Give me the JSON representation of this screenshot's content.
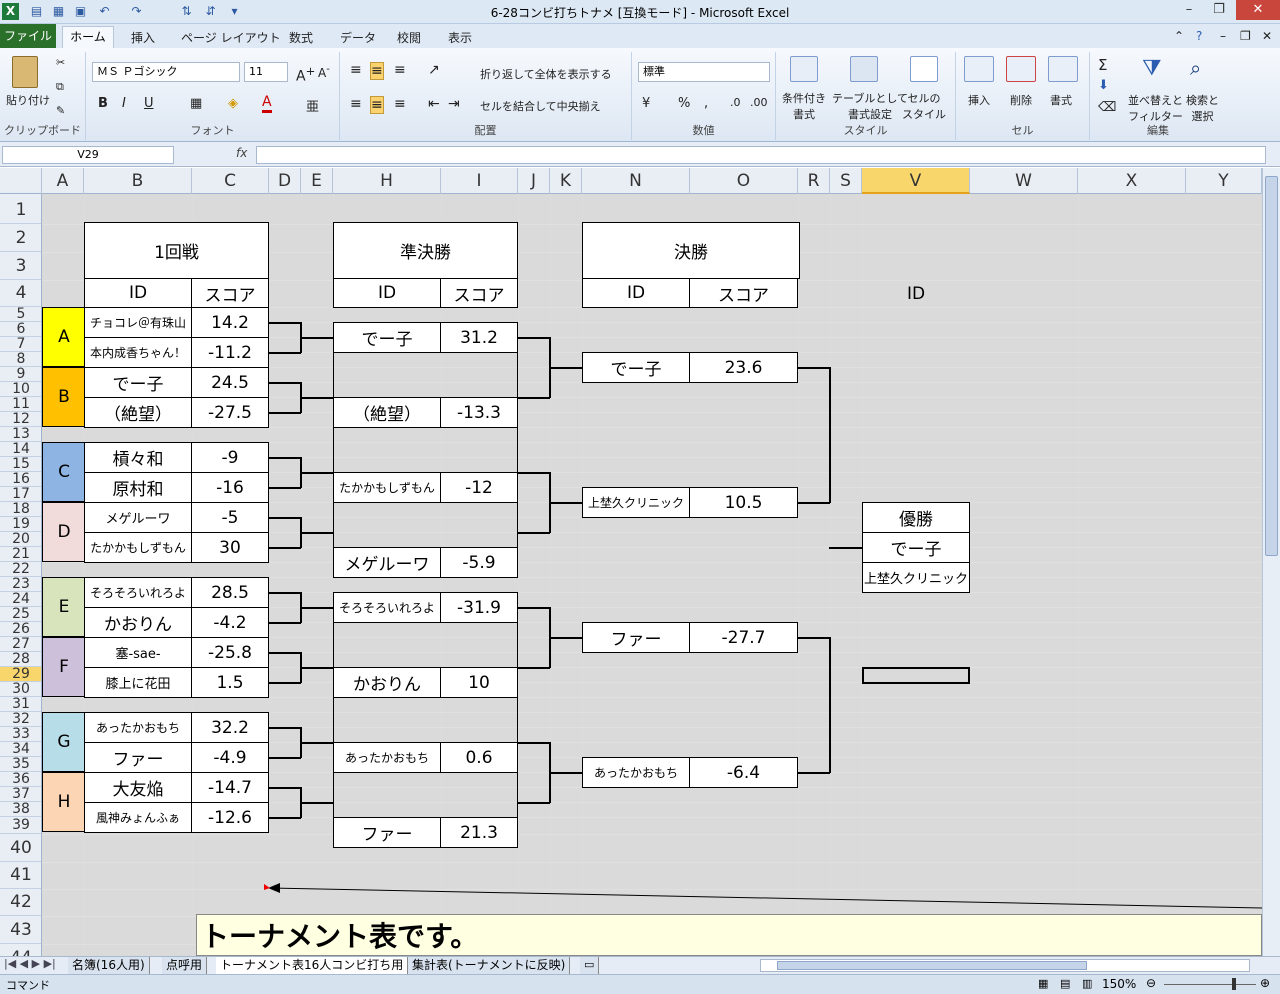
{
  "window": {
    "title": "6-28コンビ打ちトナメ [互換モード] - Microsoft Excel"
  },
  "ribbon": {
    "file_tab": "ファイル",
    "tabs": [
      "ホーム",
      "挿入",
      "ページ レイアウト",
      "数式",
      "データ",
      "校閲",
      "表示"
    ],
    "paste": "貼り付け",
    "clipboard": "クリップボード",
    "font_group": "フォント",
    "font_name": "ＭＳ Ｐゴシック",
    "font_size": "11",
    "wrap_text": "折り返して全体を表示する",
    "merge_center": "セルを結合して中央揃え",
    "alignment": "配置",
    "number_format": "標準",
    "number": "数値",
    "cond_format": "条件付き\n書式",
    "table_format": "テーブルとして\n書式設定",
    "cell_style": "セルの\nスタイル",
    "styles": "スタイル",
    "insert": "挿入",
    "delete": "削除",
    "format": "書式",
    "cells": "セル",
    "sort_filter": "並べ替えと\nフィルター",
    "find_select": "検索と\n選択",
    "editing": "編集"
  },
  "formula_bar": {
    "name_box": "V29",
    "fx": "fx",
    "value": ""
  },
  "columns": [
    "A",
    "B",
    "C",
    "D",
    "E",
    "H",
    "I",
    "J",
    "K",
    "N",
    "O",
    "R",
    "S",
    "V",
    "W",
    "X",
    "Y"
  ],
  "rows": [
    "1",
    "2",
    "3",
    "4",
    "5",
    "6",
    "7",
    "8",
    "9",
    "10",
    "11",
    "12",
    "13",
    "14",
    "15",
    "16",
    "17",
    "18",
    "19",
    "20",
    "21",
    "22",
    "23",
    "24",
    "25",
    "26",
    "27",
    "28",
    "29",
    "30",
    "31",
    "32",
    "33",
    "34",
    "35",
    "36",
    "37",
    "38",
    "39",
    "40",
    "41",
    "42",
    "43",
    "44"
  ],
  "bracket": {
    "round1_title": "1回戦",
    "semi_title": "準決勝",
    "final_title": "決勝",
    "id_header": "ID",
    "score_header": "スコア",
    "winner_id_header": "ID",
    "groups": [
      {
        "label": "A",
        "color": "#ffff00",
        "players": [
          {
            "id": "チョコレ＠有珠山",
            "score": "14.2"
          },
          {
            "id": "本内成香ちゃん！",
            "score": "-11.2"
          }
        ]
      },
      {
        "label": "B",
        "color": "#ffc000",
        "players": [
          {
            "id": "でー子",
            "score": "24.5"
          },
          {
            "id": "（絶望）",
            "score": "-27.5"
          }
        ]
      },
      {
        "label": "C",
        "color": "#8eb4e3",
        "players": [
          {
            "id": "槓々和",
            "score": "-9"
          },
          {
            "id": "原村和",
            "score": "-16"
          }
        ]
      },
      {
        "label": "D",
        "color": "#f2dcdb",
        "players": [
          {
            "id": "メゲルーワ",
            "score": "-5"
          },
          {
            "id": "たかかもしずもん",
            "score": "30"
          }
        ]
      },
      {
        "label": "E",
        "color": "#d7e4bc",
        "players": [
          {
            "id": "そろそろいれろよ",
            "score": "28.5"
          },
          {
            "id": "かおりん",
            "score": "-4.2"
          }
        ]
      },
      {
        "label": "F",
        "color": "#ccc0da",
        "players": [
          {
            "id": "塞-sae-",
            "score": "-25.8"
          },
          {
            "id": "膝上に花田",
            "score": "1.5"
          }
        ]
      },
      {
        "label": "G",
        "color": "#b7dee8",
        "players": [
          {
            "id": "あったかおもち",
            "score": "32.2"
          },
          {
            "id": "ファー",
            "score": "-4.9"
          }
        ]
      },
      {
        "label": "H",
        "color": "#fcd5b4",
        "players": [
          {
            "id": "大友焔",
            "score": "-14.7"
          },
          {
            "id": "風神みょんふぁ",
            "score": "-12.6"
          }
        ]
      }
    ],
    "semis": [
      {
        "id": "でー子",
        "score": "31.2"
      },
      {
        "id": "（絶望）",
        "score": "-13.3"
      },
      {
        "id": "たかかもしずもん",
        "score": "-12"
      },
      {
        "id": "メゲルーワ",
        "score": "-5.9"
      },
      {
        "id": "そろそろいれろよ",
        "score": "-31.9"
      },
      {
        "id": "かおりん",
        "score": "10"
      },
      {
        "id": "あったかおもち",
        "score": "0.6"
      },
      {
        "id": "ファー",
        "score": "21.3"
      }
    ],
    "finals": [
      {
        "id": "でー子",
        "score": "23.6"
      },
      {
        "id": "上埜久クリニック",
        "score": "10.5"
      },
      {
        "id": "ファー",
        "score": "-27.7"
      },
      {
        "id": "あったかおもち",
        "score": "-6.4"
      }
    ],
    "winner": {
      "title": "優勝",
      "first": "でー子",
      "second": "上埜久クリニック"
    }
  },
  "comment": "トーナメント表です。",
  "sheets": [
    "名簿(16人用)",
    "点呼用",
    "トーナメント表16人コンビ打ち用",
    "集計表(トーナメントに反映)"
  ],
  "status": {
    "mode": "コマンド",
    "zoom": "150%"
  }
}
